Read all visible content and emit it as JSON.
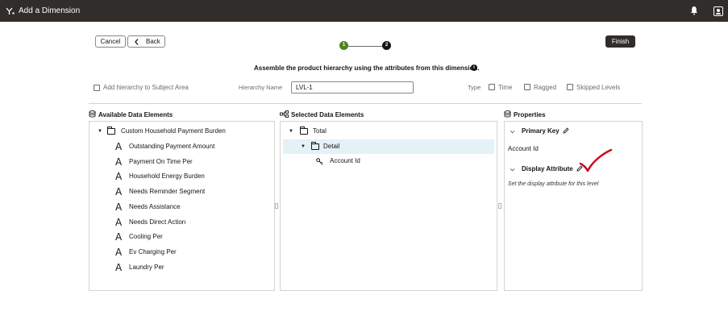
{
  "window": {
    "title": "Add a Dimension",
    "icons": [
      "dimension-app-icon",
      "notification-bell-icon",
      "user-profile-icon"
    ]
  },
  "toolbar": {
    "cancel_label": "Cancel",
    "back_label": "Back",
    "finish_label": "Finish"
  },
  "steps": [
    {
      "number": "1",
      "status": "complete",
      "color": "#508223"
    },
    {
      "number": "2",
      "status": "current",
      "color": "#161513"
    }
  ],
  "instruction": "Assemble the product hierarchy using the attributes from this dimension.",
  "hierarchy": {
    "add_to_subject_area_label": "Add hierarchy to Subject Area",
    "add_to_subject_area_checked": false,
    "name_label": "Hierarchy Name",
    "name_value": "LVL-1",
    "type_label": "Type",
    "options": [
      {
        "label": "Time",
        "checked": false
      },
      {
        "label": "Ragged",
        "checked": false
      },
      {
        "label": "Skipped Levels",
        "checked": false
      }
    ]
  },
  "available": {
    "title": "Available Data Elements",
    "folder": "Custom Household Payment Burden",
    "items": [
      "Outstanding Payment Amount",
      "Payment On Time Per",
      "Household Energy Burden",
      "Needs Reminder Segment",
      "Needs Assistance",
      "Needs Direct Action",
      "Cooling Per",
      "Ev Charging Per",
      "Laundry Per"
    ]
  },
  "selected": {
    "title": "Selected Data Elements",
    "root": "Total",
    "level": "Detail",
    "key": "Account Id"
  },
  "properties": {
    "title": "Properties",
    "primary_key_label": "Primary Key",
    "primary_key_value": "Account Id",
    "display_attribute_label": "Display Attribute",
    "display_attribute_hint": "Set the display attribute for this level"
  },
  "colors": {
    "header_bg": "#312d2a",
    "step_complete": "#508223",
    "selection_bg": "#e4f1f7",
    "annotation_check": "#d0021b"
  }
}
